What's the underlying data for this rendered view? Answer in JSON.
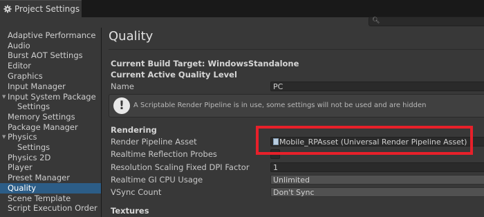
{
  "window": {
    "tab_title": "Project Settings",
    "tab_icon": "gear-icon",
    "search_icon": "search-icon",
    "search_placeholder": ""
  },
  "sidebar": {
    "items": [
      {
        "label": "Adaptive Performance"
      },
      {
        "label": "Audio"
      },
      {
        "label": "Burst AOT Settings"
      },
      {
        "label": "Editor"
      },
      {
        "label": "Graphics"
      },
      {
        "label": "Input Manager"
      },
      {
        "label": "Input System Package"
      },
      {
        "label": "Settings"
      },
      {
        "label": "Memory Settings"
      },
      {
        "label": "Package Manager"
      },
      {
        "label": "Physics"
      },
      {
        "label": "Settings"
      },
      {
        "label": "Physics 2D"
      },
      {
        "label": "Player"
      },
      {
        "label": "Preset Manager"
      },
      {
        "label": "Quality"
      },
      {
        "label": "Scene Template"
      },
      {
        "label": "Script Execution Order"
      }
    ],
    "selected": "Quality"
  },
  "main": {
    "title": "Quality",
    "build_target": "Current Build Target: WindowsStandalone",
    "active_level": "Current Active Quality Level",
    "name_label": "Name",
    "name_value": "PC",
    "info_message": "A Scriptable Render Pipeline is in use, some settings will not be used and are hidden",
    "rendering_header": "Rendering",
    "rows": {
      "render_pipeline_asset": {
        "label": "Render Pipeline Asset",
        "value": "Mobile_RPAsset (Universal Render Pipeline Asset)"
      },
      "realtime_reflection_probes": {
        "label": "Realtime Reflection Probes",
        "checked": false
      },
      "resolution_scaling": {
        "label": "Resolution Scaling Fixed DPI Factor",
        "value": "1"
      },
      "realtime_gi": {
        "label": "Realtime GI CPU Usage",
        "value": "Unlimited"
      },
      "vsync": {
        "label": "VSync Count",
        "value": "Don't Sync"
      }
    },
    "textures_header": "Textures"
  },
  "colors": {
    "highlight": "#e8202a",
    "selection": "#2c5d87"
  }
}
